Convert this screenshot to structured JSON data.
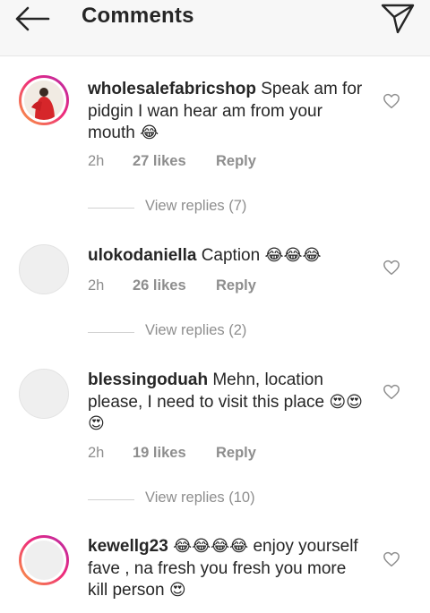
{
  "header": {
    "title": "Comments",
    "back_icon": "arrow-left-icon",
    "send_icon": "paper-plane-icon"
  },
  "comments": [
    {
      "username": "wholesalefabricshop",
      "text": " Speak am for pidgin I wan hear am from your mouth ",
      "emojis": "😂",
      "time": "2h",
      "likes": "27 likes",
      "reply": "Reply",
      "view_replies": "View replies (7)",
      "avatar_ring": true
    },
    {
      "username": "ulokodaniella",
      "text": " Caption ",
      "emojis": "😂😂😂",
      "time": "2h",
      "likes": "26 likes",
      "reply": "Reply",
      "view_replies": "View replies (2)",
      "avatar_ring": false
    },
    {
      "username": "blessingoduah",
      "text": " Mehn, location please,  I need to visit this place ",
      "emojis": "😍😍😍",
      "time": "2h",
      "likes": "19 likes",
      "reply": "Reply",
      "view_replies": "View replies (10)",
      "avatar_ring": false
    },
    {
      "username": "kewellg23",
      "text_before": " ",
      "emojis_before": "😂😂😂😂",
      "text": " enjoy yourself fave , na fresh you fresh you more kill person ",
      "emojis": "😍",
      "avatar_ring": true
    }
  ],
  "colors": {
    "header_bg": "#f7f7f7",
    "meta_gray": "#8e8e8e",
    "text_dark": "#262626",
    "story_ring_start": "#f9a03f",
    "story_ring_end": "#b52ba9"
  }
}
